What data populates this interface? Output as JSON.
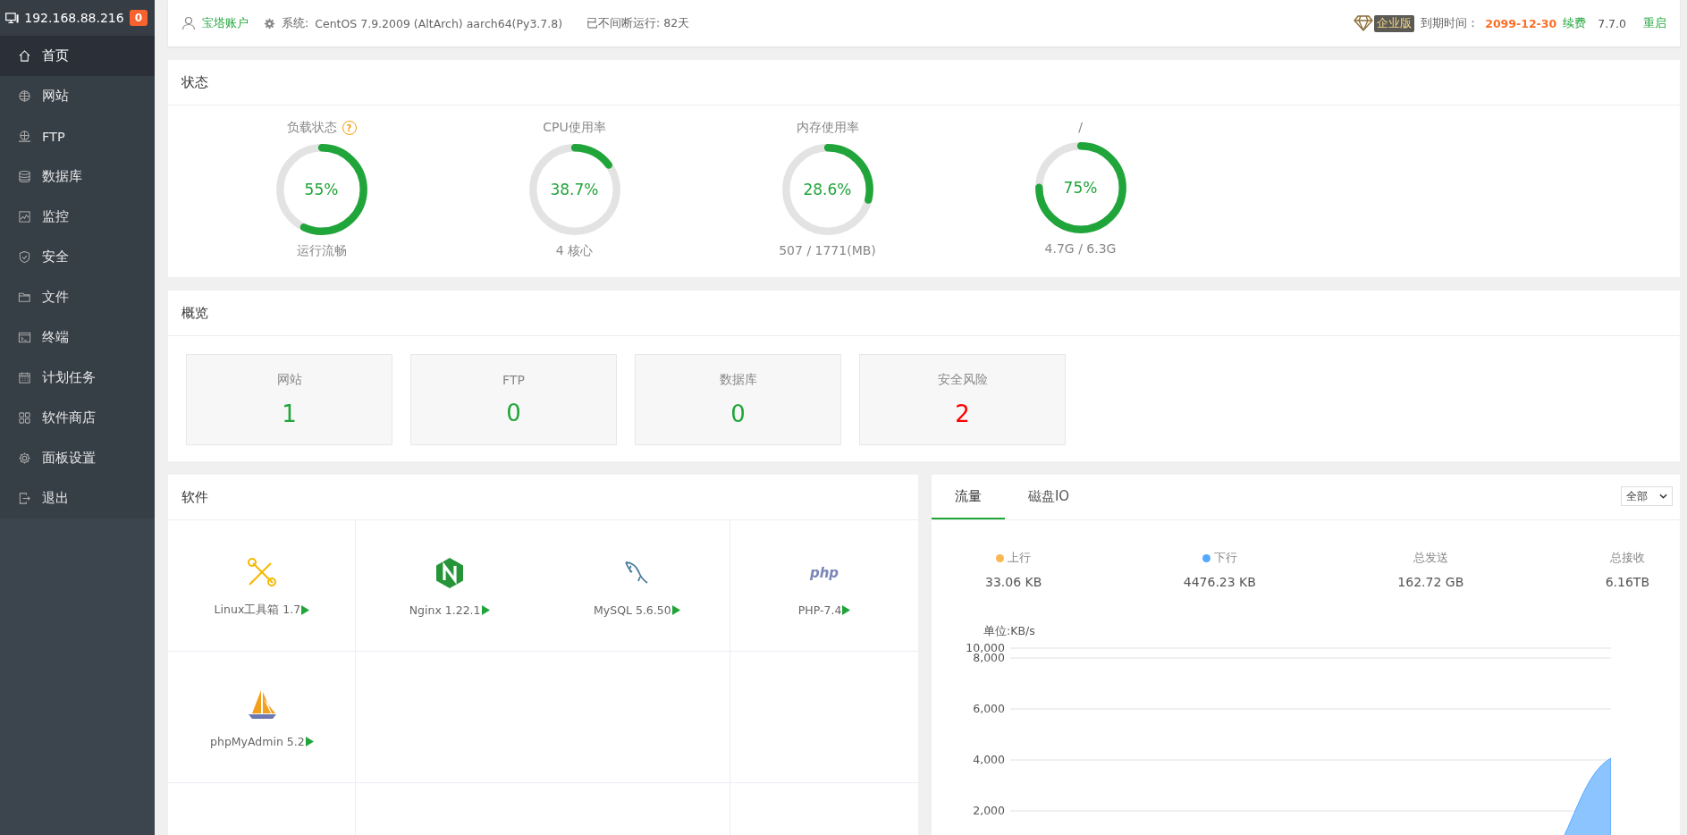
{
  "sidebar": {
    "host": "192.168.88.216",
    "badge": "0",
    "items": [
      {
        "label": "首页",
        "kind": "home",
        "selected": true
      },
      {
        "label": "网站",
        "kind": "globe",
        "selected": false
      },
      {
        "label": "FTP",
        "kind": "ftp",
        "selected": false
      },
      {
        "label": "数据库",
        "kind": "database",
        "selected": false
      },
      {
        "label": "监控",
        "kind": "monitor",
        "selected": false
      },
      {
        "label": "安全",
        "kind": "shield",
        "selected": false
      },
      {
        "label": "文件",
        "kind": "folder",
        "selected": false
      },
      {
        "label": "终端",
        "kind": "terminal",
        "selected": false
      },
      {
        "label": "计划任务",
        "kind": "calendar",
        "selected": false
      },
      {
        "label": "软件商店",
        "kind": "grid",
        "selected": false
      },
      {
        "label": "面板设置",
        "kind": "gear",
        "selected": false
      },
      {
        "label": "退出",
        "kind": "logout",
        "selected": false
      }
    ]
  },
  "top_bar": {
    "account": "宝塔账户",
    "system_label": "系统:",
    "system": "CentOS 7.9.2009 (AltArch) aarch64(Py3.7.8)",
    "uptime": "已不间断运行: 82天",
    "edition": "企业版",
    "expire_label": "到期时间：",
    "expire_date": "2099-12-30",
    "renew": "续费",
    "version": "7.7.0",
    "restart": "重启"
  },
  "status": {
    "title": "状态",
    "gauges": [
      {
        "label": "负载状态",
        "help": "?",
        "value": "55%",
        "level": 0.57,
        "caption": "运行流畅"
      },
      {
        "label": "CPU使用率",
        "value": "38.7%",
        "level": 0.15,
        "caption": "4 核心"
      },
      {
        "label": "内存使用率",
        "value": "28.6%",
        "level": 0.29,
        "caption": "507 / 1771(MB)"
      },
      {
        "label": "/",
        "value": "75%",
        "level": 0.75,
        "caption": "4.7G / 6.3G"
      }
    ]
  },
  "overview": {
    "title": "概览",
    "cards": [
      {
        "label": "网站",
        "value": "1",
        "color": "#20a53a"
      },
      {
        "label": "FTP",
        "value": "0",
        "color": "#20a53a"
      },
      {
        "label": "数据库",
        "value": "0",
        "color": "#20a53a"
      },
      {
        "label": "安全风险",
        "value": "2",
        "color": "#ff0000"
      }
    ]
  },
  "software": {
    "title": "软件",
    "items": [
      {
        "name": "Linux工具箱 1.7",
        "kind": "tools"
      },
      {
        "name": "Nginx 1.22.1",
        "kind": "nginx"
      },
      {
        "name": "MySQL 5.6.50",
        "kind": "mysql"
      },
      {
        "name": "PHP-7.4 ",
        "kind": "php"
      },
      {
        "name": "phpMyAdmin 5.2",
        "kind": "phpmyadmin"
      }
    ]
  },
  "traffic": {
    "tabs": [
      {
        "label": "流量",
        "selected": true
      },
      {
        "label": "磁盘IO",
        "selected": false
      }
    ],
    "filter": "全部",
    "stats": [
      {
        "label": "上行",
        "value": "33.06 KB",
        "color": "#f7b851"
      },
      {
        "label": "下行",
        "value": "4476.23 KB",
        "color": "#52a9ff"
      },
      {
        "label": "总发送",
        "value": "162.72 GB"
      },
      {
        "label": "总接收",
        "value": "6.16TB"
      }
    ],
    "chart": {
      "unit": "单位:KB/s",
      "y_labels": [
        "10,000",
        "8,000",
        "6,000",
        "4,000",
        "2,000"
      ]
    }
  }
}
